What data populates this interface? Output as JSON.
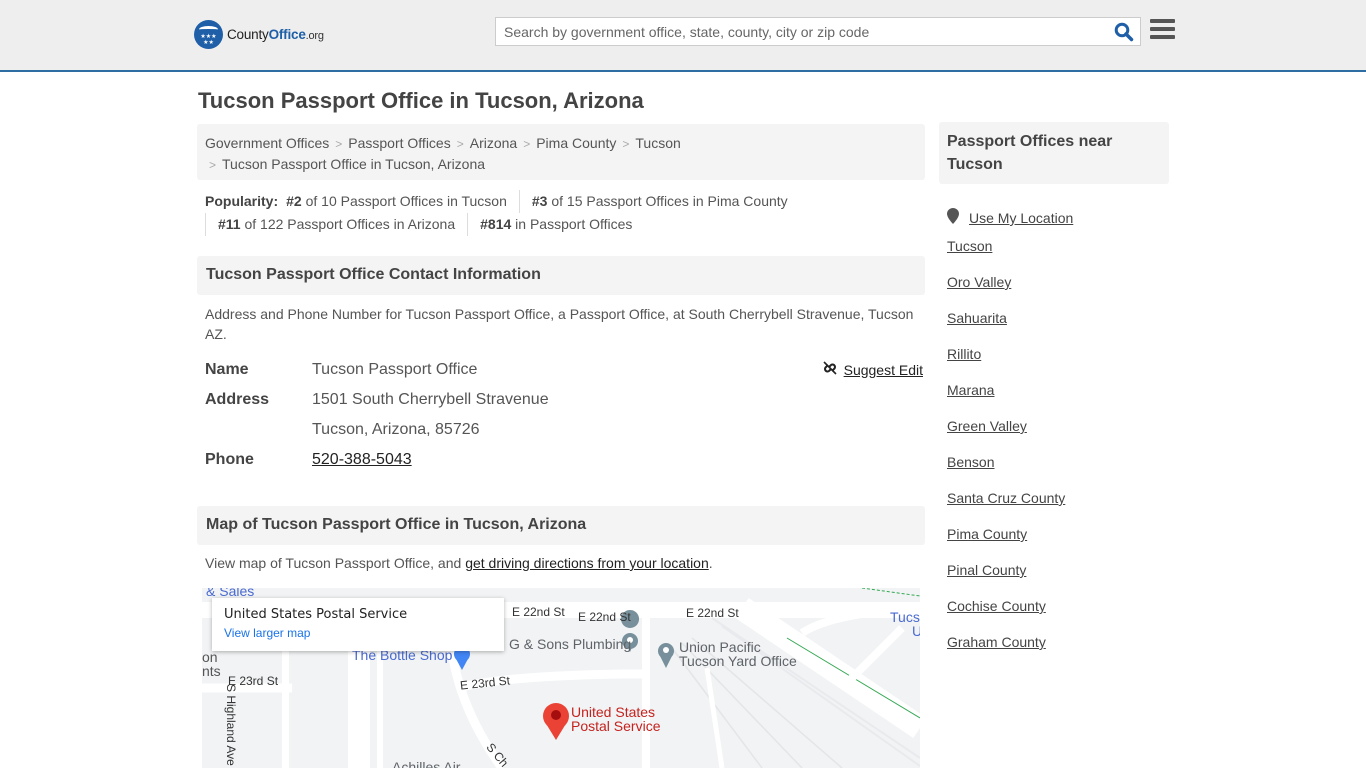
{
  "header": {
    "logo": {
      "name_plain": "County",
      "name_brand": "Office",
      "tld": ".org"
    },
    "search": {
      "placeholder": "Search by government office, state, county, city or zip code",
      "value": ""
    },
    "search_icon": "search-icon",
    "menu_icon": "hamburger-menu-icon"
  },
  "page": {
    "title": "Tucson Passport Office in Tucson, Arizona",
    "breadcrumb": [
      "Government Offices",
      "Passport Offices",
      "Arizona",
      "Pima County",
      "Tucson",
      "Tucson Passport Office in Tucson, Arizona"
    ],
    "popularity": {
      "label": "Popularity:",
      "items": [
        {
          "rank": "#2",
          "text": " of 10 Passport Offices in Tucson"
        },
        {
          "rank": "#3",
          "text": " of 15 Passport Offices in Pima County"
        },
        {
          "rank": "#11",
          "text": " of 122 Passport Offices in Arizona"
        },
        {
          "rank": "#814",
          "text": " in Passport Offices"
        }
      ]
    }
  },
  "contact": {
    "heading": "Tucson Passport Office Contact Information",
    "description": "Address and Phone Number for Tucson Passport Office, a Passport Office, at South Cherrybell Stravenue, Tucson AZ.",
    "suggest_edit": "Suggest Edit",
    "fields": {
      "name_label": "Name",
      "name_value": "Tucson Passport Office",
      "address_label": "Address",
      "address_line1": "1501 South Cherrybell Stravenue",
      "address_line2": "Tucson, Arizona, 85726",
      "phone_label": "Phone",
      "phone_value": "520-388-5043"
    }
  },
  "map_section": {
    "heading": "Map of Tucson Passport Office in Tucson, Arizona",
    "desc_prefix": "View map of Tucson Passport Office, and ",
    "desc_link": "get driving directions from your location",
    "desc_suffix": ".",
    "card": {
      "title": "United States Postal Service",
      "link": "View larger map"
    },
    "labels": {
      "sales": "& Sales",
      "e22_1": "E 22nd St",
      "e22_2": "E 22nd St",
      "e22_3": "E 22nd St",
      "e23_1": "E 23rd St",
      "e23_2": "E 23rd St",
      "highland": "S Highland Ave",
      "cherrybell": "S Ch",
      "on": "on",
      "nts": "nts",
      "sons_plumbing": "G & Sons Plumbing",
      "bottle_shop": "The Bottle Shop",
      "union_pacific_1": "Union Pacific",
      "union_pacific_2": "Tucson Yard Office",
      "usps_1": "United States",
      "usps_2": "Postal Service",
      "achilles": "Achilles Air",
      "tucs": "Tucs",
      "u": "U"
    }
  },
  "sidebar": {
    "heading": "Passport Offices near Tucson",
    "use_location": "Use My Location",
    "items": [
      "Tucson",
      "Oro Valley",
      "Sahuarita",
      "Rillito",
      "Marana",
      "Green Valley",
      "Benson",
      "Santa Cruz County",
      "Pima County",
      "Pinal County",
      "Cochise County",
      "Graham County"
    ]
  }
}
